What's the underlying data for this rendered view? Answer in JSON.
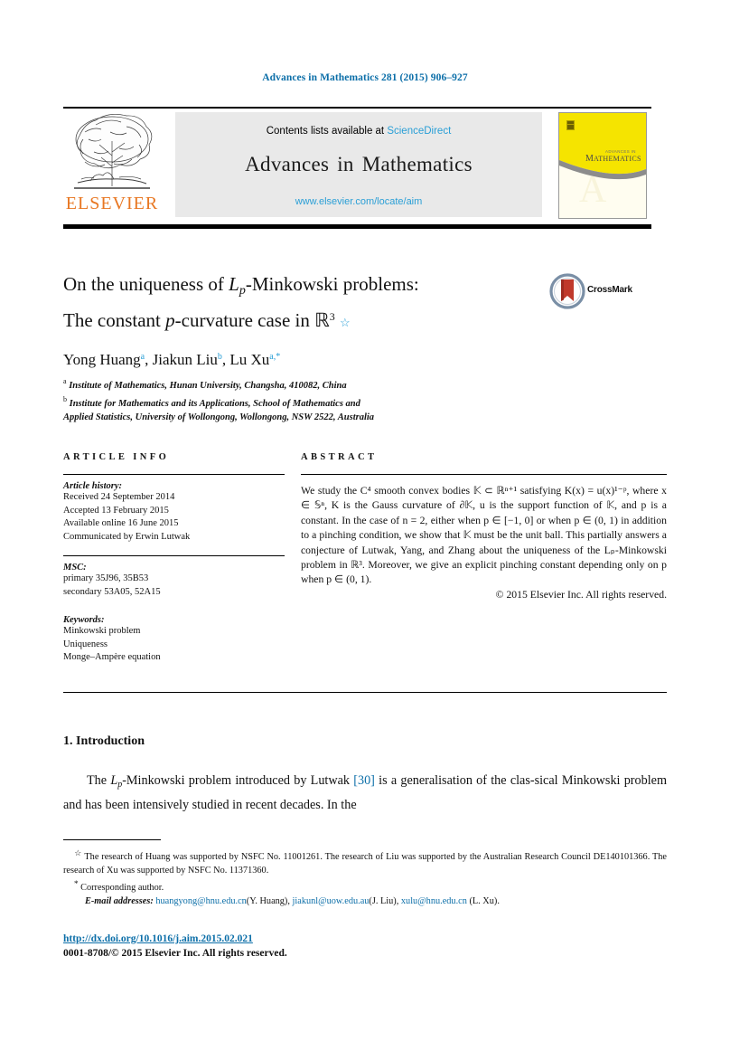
{
  "running_head": "Advances in Mathematics 281 (2015) 906–927",
  "masthead": {
    "contents_prefix": "Contents lists available at",
    "sciencedirect": "ScienceDirect",
    "journal_title_a": "Advances",
    "journal_title_b": "in",
    "journal_title_c": "Mathematics",
    "journal_url": "www.elsevier.com/locate/aim",
    "publisher_wordmark": "ELSEVIER",
    "cover_title_small": "ADVANCES IN",
    "cover_title_large": "MATHEMATICS",
    "cover_watermark": "A"
  },
  "title": {
    "line1_pre": "On the uniqueness of ",
    "line1_math_l": "L",
    "line1_math_sub": "p",
    "line1_post": "-Minkowski problems:",
    "line2_pre": "The constant ",
    "line2_math": "p",
    "line2_mid": "-curvature case in ℝ",
    "line2_sup": "3",
    "line2_star": "☆"
  },
  "crossmark": {
    "label": "CrossMark"
  },
  "authors": {
    "a1_name": "Yong Huang",
    "a1_mark": "a",
    "sep1": ", ",
    "a2_name": "Jiakun Liu",
    "a2_mark": "b",
    "sep2": ", ",
    "a3_name": "Lu Xu",
    "a3_mark": "a,*"
  },
  "affiliations": [
    {
      "mark": "a",
      "text": "Institute of Mathematics, Hunan University, Changsha, 410082, China"
    },
    {
      "mark": "b",
      "text": "Institute for Mathematics and its Applications, School of Mathematics and"
    },
    {
      "mark": "",
      "text": "Applied Statistics, University of Wollongong, Wollongong, NSW 2522, Australia"
    }
  ],
  "article_info": {
    "heading": "ARTICLE INFO",
    "history_label": "Article history:",
    "history": [
      "Received 24 September 2014",
      "Accepted 13 February 2015",
      "Available online 16 June 2015",
      "Communicated by Erwin Lutwak"
    ],
    "msc_label": "MSC:",
    "msc": [
      "primary 35J96, 35B53",
      "secondary 53A05, 52A15"
    ],
    "keywords_label": "Keywords:",
    "keywords": [
      "Minkowski problem",
      "Uniqueness",
      "Monge–Ampère equation"
    ]
  },
  "abstract": {
    "heading": "ABSTRACT",
    "text": "We study the C⁴ smooth convex bodies 𝕂 ⊂ ℝⁿ⁺¹ satisfying K(x) = u(x)¹⁻ᵖ, where x ∈ 𝕊ⁿ, K is the Gauss curvature of ∂𝕂, u is the support function of 𝕂, and p is a constant. In the case of n = 2, either when p ∈ [−1, 0] or when p ∈ (0, 1) in addition to a pinching condition, we show that 𝕂 must be the unit ball. This partially answers a conjecture of Lutwak, Yang, and Zhang about the uniqueness of the Lₚ-Minkowski problem in ℝ³. Moreover, we give an explicit pinching constant depending only on p when p ∈ (0, 1).",
    "copyright": "© 2015 Elsevier Inc. All rights reserved."
  },
  "introduction": {
    "heading": "1.  Introduction",
    "para_pre": "The ",
    "para_math_l": "L",
    "para_math_sub": "p",
    "para_mid": "-Minkowski problem introduced by Lutwak ",
    "citation": "[30]",
    "para_post": " is a generalisation of the clas-sical Minkowski problem and has been intensively studied in recent decades. In the"
  },
  "footnotes": {
    "fn_star_mark": "☆",
    "fn_star_text": "The research of Huang was supported by NSFC No. 11001261. The research of Liu was supported by the Australian Research Council DE140101366. The research of Xu was supported by NSFC No. 11371360.",
    "fn_corr_mark": "*",
    "fn_corr_text": "Corresponding author.",
    "email_label": "E-mail addresses:",
    "emails": [
      {
        "address": "huangyong@hnu.edu.cn",
        "who": "(Y. Huang)",
        "sep": ", "
      },
      {
        "address": "jiakunl@uow.edu.au",
        "who": "(J. Liu)",
        "sep": ", "
      },
      {
        "address": "xulu@hnu.edu.cn",
        "who": "",
        "sep": ""
      }
    ],
    "email_tail": "(L. Xu)."
  },
  "footer": {
    "doi": "http://dx.doi.org/10.1016/j.aim.2015.02.021",
    "issn": "0001-8708/© 2015 Elsevier Inc. All rights reserved."
  },
  "colors": {
    "link_blue": "#0b6ea8",
    "sciencedirect_blue": "#2a9fd6",
    "elsevier_orange": "#e87722",
    "cover_yellow": "#f5e400",
    "crossmark_red": "#c0392b"
  }
}
